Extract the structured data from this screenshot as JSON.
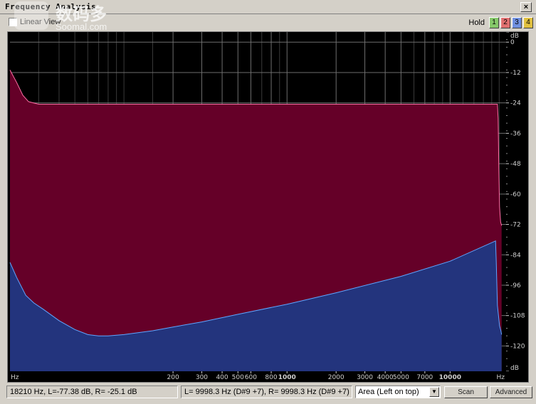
{
  "window": {
    "title": "Frequency Analysis",
    "close_label": "×"
  },
  "toolbar": {
    "linear_view_label": "Linear View",
    "hold_label": "Hold",
    "hold_buttons": [
      {
        "label": "1",
        "color": "#86c86a"
      },
      {
        "label": "2",
        "color": "#e07070"
      },
      {
        "label": "3",
        "color": "#7090e0"
      },
      {
        "label": "4",
        "color": "#e0c040"
      }
    ]
  },
  "watermark": {
    "cn": "数码多",
    "en": "Soomal.com"
  },
  "chart_data": {
    "type": "area",
    "x_scale": "log",
    "xlim": [
      20,
      22050
    ],
    "ylim": [
      -130,
      4
    ],
    "x_ticks": [
      {
        "label": "Hz",
        "value": 20
      },
      {
        "label": "200",
        "value": 200
      },
      {
        "label": "300",
        "value": 300
      },
      {
        "label": "400",
        "value": 400
      },
      {
        "label": "500",
        "value": 500
      },
      {
        "label": "600",
        "value": 600
      },
      {
        "label": "800",
        "value": 800
      },
      {
        "label": "1000",
        "value": 1000
      },
      {
        "label": "2000",
        "value": 2000
      },
      {
        "label": "3000",
        "value": 3000
      },
      {
        "label": "4000",
        "value": 4000
      },
      {
        "label": "5000",
        "value": 5000
      },
      {
        "label": "7000",
        "value": 7000
      },
      {
        "label": "10000",
        "value": 10000
      },
      {
        "label": "Hz",
        "value": 22050
      }
    ],
    "y_ticks": [
      {
        "label": "dB",
        "value": 4
      },
      {
        "label": "0",
        "value": 0
      },
      {
        "label": "-12",
        "value": -12
      },
      {
        "label": "-24",
        "value": -24
      },
      {
        "label": "-36",
        "value": -36
      },
      {
        "label": "-48",
        "value": -48
      },
      {
        "label": "-60",
        "value": -60
      },
      {
        "label": "-72",
        "value": -72
      },
      {
        "label": "-84",
        "value": -84
      },
      {
        "label": "-96",
        "value": -96
      },
      {
        "label": "-108",
        "value": -108
      },
      {
        "label": "-120",
        "value": -120
      },
      {
        "label": "dB",
        "value": -130
      }
    ],
    "minor_x_gridlines": [
      30,
      40,
      50,
      60,
      70,
      80,
      90,
      100,
      150,
      700,
      900,
      6000,
      8000,
      9000,
      12000,
      14000,
      16000,
      18000,
      20000
    ],
    "series": [
      {
        "color": "#650028",
        "line_color": "#ff6ea6",
        "points": [
          [
            20,
            -11
          ],
          [
            22,
            -16
          ],
          [
            24,
            -21
          ],
          [
            26,
            -23.5
          ],
          [
            30,
            -24.5
          ],
          [
            40,
            -24.5
          ],
          [
            1000,
            -24.5
          ],
          [
            10000,
            -24.5
          ],
          [
            19500,
            -24.5
          ],
          [
            19700,
            -30
          ],
          [
            19900,
            -50
          ],
          [
            20100,
            -65
          ],
          [
            20400,
            -71
          ],
          [
            20700,
            -72.5
          ]
        ]
      },
      {
        "color": "#23347d",
        "line_color": "#5fa6ff",
        "points": [
          [
            20,
            -87
          ],
          [
            22,
            -93
          ],
          [
            25,
            -100
          ],
          [
            28,
            -103
          ],
          [
            32,
            -105.5
          ],
          [
            40,
            -110
          ],
          [
            50,
            -113.5
          ],
          [
            60,
            -115.5
          ],
          [
            70,
            -116
          ],
          [
            80,
            -116
          ],
          [
            100,
            -115.5
          ],
          [
            150,
            -114
          ],
          [
            200,
            -112.5
          ],
          [
            300,
            -110.5
          ],
          [
            500,
            -107.5
          ],
          [
            1000,
            -103.5
          ],
          [
            2000,
            -99
          ],
          [
            5000,
            -92.5
          ],
          [
            10000,
            -86.5
          ],
          [
            19000,
            -78.5
          ],
          [
            19200,
            -87
          ],
          [
            19500,
            -104
          ],
          [
            19800,
            -108
          ],
          [
            20100,
            -112
          ],
          [
            20500,
            -114
          ],
          [
            20700,
            -115.5
          ]
        ]
      }
    ]
  },
  "status": {
    "cursor": "18210 Hz, L=-77.38 dB, R= -25.1 dB",
    "peak": "L= 9998.3 Hz (D#9 +7), R= 9998.3 Hz (D#9 +7)",
    "view_mode": "Area (Left on top)",
    "scan_label": "Scan",
    "advanced_label": "Advanced"
  }
}
